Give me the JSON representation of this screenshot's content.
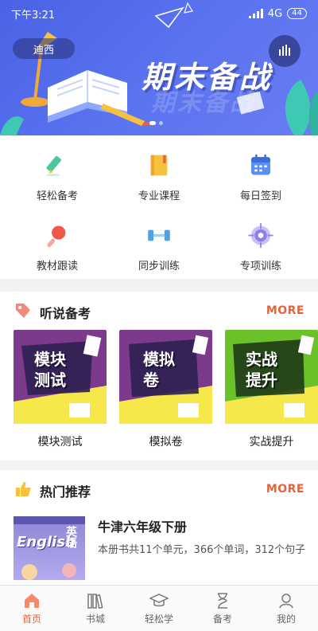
{
  "status_bar": {
    "time": "下午3:21",
    "network": "4G",
    "battery": "44"
  },
  "banner": {
    "location": "迪西",
    "title": "期末备战"
  },
  "quick_grid": [
    {
      "label": "轻松备考",
      "icon": "pencil-icon"
    },
    {
      "label": "专业课程",
      "icon": "book-icon"
    },
    {
      "label": "每日签到",
      "icon": "calendar-icon"
    },
    {
      "label": "教材跟读",
      "icon": "microphone-icon"
    },
    {
      "label": "同步训练",
      "icon": "dumbbell-icon"
    },
    {
      "label": "专项训练",
      "icon": "target-icon"
    }
  ],
  "listening": {
    "title": "听说备考",
    "more": "MORE",
    "cards": [
      {
        "label": "模块测试",
        "poster_line1": "模块",
        "poster_line2": "测试"
      },
      {
        "label": "模拟卷",
        "poster_line1": "模拟",
        "poster_line2": "卷"
      },
      {
        "label": "实战提升",
        "poster_line1": "实战",
        "poster_line2": "提升"
      }
    ]
  },
  "hot": {
    "title": "热门推荐",
    "more": "MORE",
    "book": {
      "cover_en": "English",
      "cover_cn": "英语",
      "title": "牛津六年级下册",
      "desc": "本册书共11个单元，366个单词，312个句子"
    }
  },
  "bottom_nav": [
    {
      "label": "首页",
      "icon": "home-icon",
      "active": true
    },
    {
      "label": "书城",
      "icon": "bookshelf-icon",
      "active": false
    },
    {
      "label": "轻松学",
      "icon": "graduation-cap-icon",
      "active": false
    },
    {
      "label": "备考",
      "icon": "hourglass-icon",
      "active": false
    },
    {
      "label": "我的",
      "icon": "user-icon",
      "active": false
    }
  ],
  "colors": {
    "banner": "#4a63e6",
    "accent": "#e8613d",
    "card_purple": "#7b3a8c",
    "card_green": "#6bc12a"
  }
}
